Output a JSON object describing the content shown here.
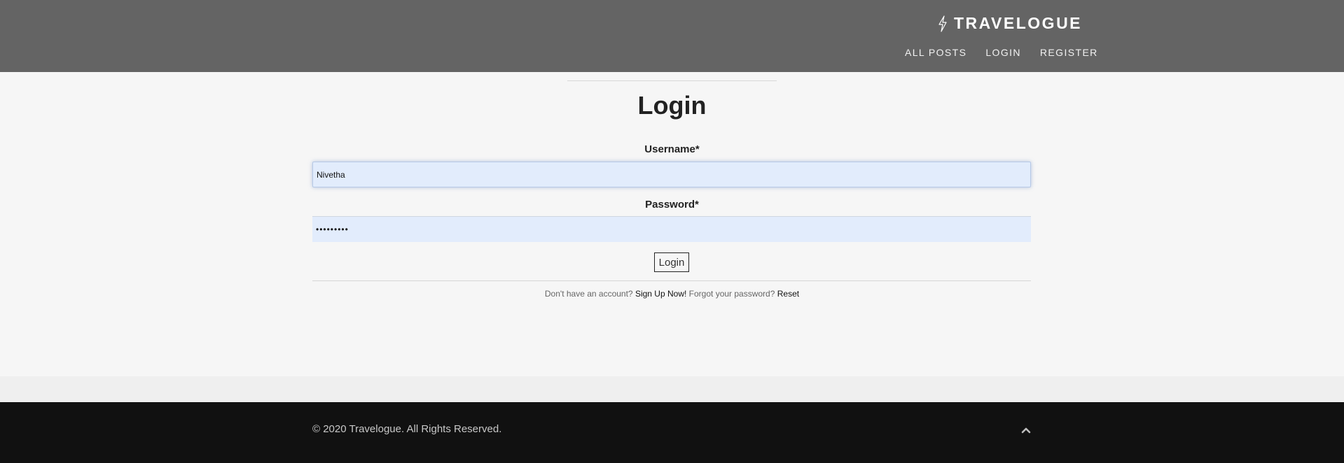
{
  "header": {
    "brand": "TRAVELOGUE",
    "brand_icon": "lightning-bolt-icon",
    "nav": [
      {
        "label": "ALL POSTS"
      },
      {
        "label": "LOGIN"
      },
      {
        "label": "REGISTER"
      }
    ]
  },
  "main": {
    "title": "Login",
    "username_label": "Username*",
    "username_value": "Nivetha",
    "password_label": "Password*",
    "password_value": "•••••••••",
    "submit_label": "Login",
    "no_account_text": "Don't have an account?",
    "signup_link": "Sign Up Now!",
    "forgot_text": "Forgot your password?",
    "reset_link": "Reset"
  },
  "footer": {
    "copyright": "© 2020 Travelogue. All Rights Reserved.",
    "back_to_top_icon": "chevron-up-icon"
  },
  "colors": {
    "header_bg": "#646464",
    "input_bg": "#e2ecfc",
    "footer_bg": "#111111"
  }
}
